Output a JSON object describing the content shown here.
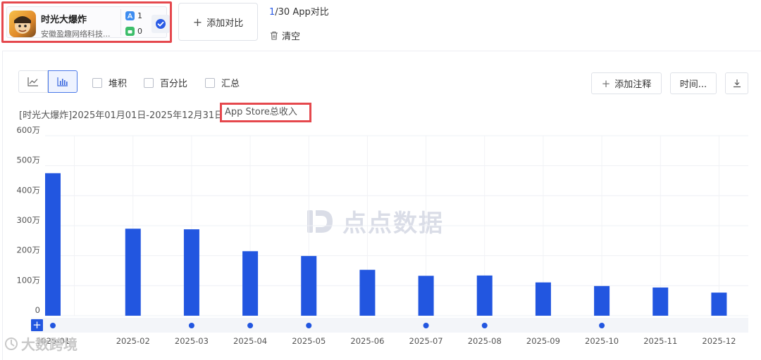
{
  "app": {
    "name": "时光大爆炸",
    "developer": "安徽盈趣网络科技...",
    "ios_count": "1",
    "gp_count": "0"
  },
  "toolbar_top": {
    "add_compare": "添加对比",
    "counter_current": "1",
    "counter_rest": "/30 App对比",
    "clear": "清空"
  },
  "options": {
    "stack": "堆积",
    "percent": "百分比",
    "total": "汇总",
    "add_note": "添加注释",
    "time": "时间...",
    "download_icon": "download-icon"
  },
  "subtitle_prefix": "[时光大爆炸]2025年01月01日-2025年12月31日",
  "metric": "App Store总收入",
  "watermark": "点点数据",
  "corner_watermark": "大数跨境",
  "plus_marker": "+",
  "colors": {
    "bar": "#2256e0",
    "accent": "#2b5ce6",
    "highlight": "#e5484d"
  },
  "chart_data": {
    "type": "bar",
    "categories": [
      "2025-01",
      "2025-02",
      "2025-03",
      "2025-04",
      "2025-05",
      "2025-06",
      "2025-07",
      "2025-08",
      "2025-09",
      "2025-10",
      "2025-11",
      "2025-12"
    ],
    "series": [
      {
        "values": [
          4750000,
          2900000,
          2880000,
          2150000,
          1990000,
          1530000,
          1330000,
          1340000,
          1110000,
          990000,
          940000,
          770000
        ]
      }
    ],
    "ylim": [
      0,
      6000000
    ],
    "y_ticks": [
      "0",
      "100万",
      "200万",
      "300万",
      "400万",
      "500万",
      "600万"
    ],
    "annotation_months": [
      "2025-01",
      "2025-03",
      "2025-04",
      "2025-05",
      "2025-07",
      "2025-08",
      "2025-10"
    ],
    "grid": true
  }
}
